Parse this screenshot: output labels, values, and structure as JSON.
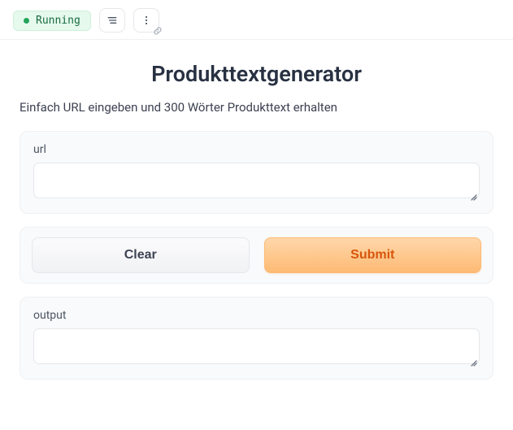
{
  "topbar": {
    "status_label": "Running"
  },
  "header": {
    "title": "Produkttextgenerator",
    "subtitle": "Einfach URL eingeben und 300 Wörter Produkttext erhalten"
  },
  "input_panel": {
    "label": "url",
    "value": ""
  },
  "buttons": {
    "clear_label": "Clear",
    "submit_label": "Submit"
  },
  "output_panel": {
    "label": "output",
    "value": ""
  }
}
